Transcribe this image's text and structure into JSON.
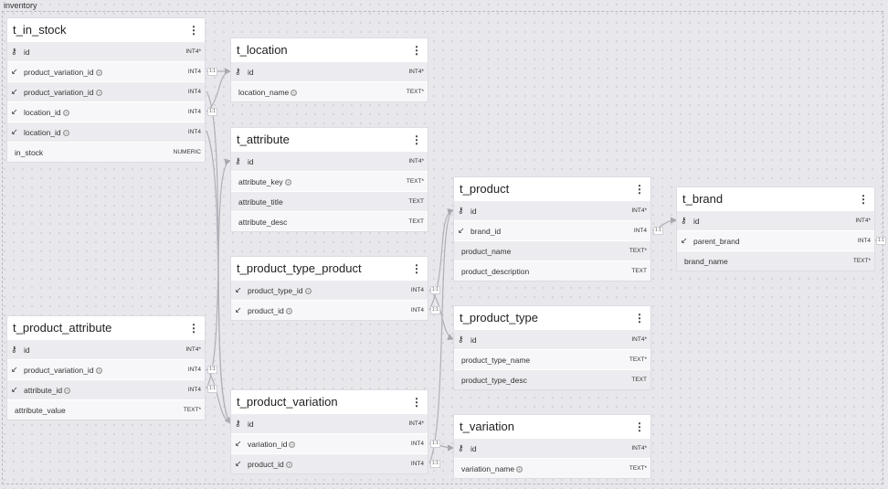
{
  "group_label": "inventory",
  "icons": {
    "pk": "key-icon",
    "fk": "arrow-southwest-icon",
    "menu": "kebab-menu-icon",
    "ref": "fingerprint-icon"
  },
  "colors": {
    "canvas": "#e7e7ec",
    "header": "#ffffff",
    "link": "#b0b0b8"
  },
  "cardinality": "1:1",
  "tables": {
    "t_in_stock": {
      "name": "t_in_stock",
      "columns": [
        {
          "name": "id",
          "type": "INT4*",
          "kind": "pk"
        },
        {
          "name": "product_variation_id",
          "type": "INT4",
          "kind": "fk",
          "ref": true
        },
        {
          "name": "product_variation_id",
          "type": "INT4",
          "kind": "fk",
          "ref": true
        },
        {
          "name": "location_id",
          "type": "INT4",
          "kind": "fk",
          "ref": true
        },
        {
          "name": "location_id",
          "type": "INT4",
          "kind": "fk",
          "ref": true
        },
        {
          "name": "in_stock",
          "type": "NUMERIC",
          "kind": "col"
        }
      ]
    },
    "t_location": {
      "name": "t_location",
      "columns": [
        {
          "name": "id",
          "type": "INT4*",
          "kind": "pk"
        },
        {
          "name": "location_name",
          "type": "TEXT*",
          "kind": "col",
          "ref": true
        }
      ]
    },
    "t_attribute": {
      "name": "t_attribute",
      "columns": [
        {
          "name": "id",
          "type": "INT4*",
          "kind": "pk"
        },
        {
          "name": "attribute_key",
          "type": "TEXT*",
          "kind": "col",
          "ref": true
        },
        {
          "name": "attribute_title",
          "type": "TEXT",
          "kind": "col"
        },
        {
          "name": "attribute_desc",
          "type": "TEXT",
          "kind": "col"
        }
      ]
    },
    "t_product_type_product": {
      "name": "t_product_type_product",
      "columns": [
        {
          "name": "product_type_id",
          "type": "INT4",
          "kind": "fk",
          "ref": true
        },
        {
          "name": "product_id",
          "type": "INT4",
          "kind": "fk",
          "ref": true
        }
      ]
    },
    "t_product_attribute": {
      "name": "t_product_attribute",
      "columns": [
        {
          "name": "id",
          "type": "INT4*",
          "kind": "pk"
        },
        {
          "name": "product_variation_id",
          "type": "INT4",
          "kind": "fk",
          "ref": true
        },
        {
          "name": "attribute_id",
          "type": "INT4",
          "kind": "fk",
          "ref": true
        },
        {
          "name": "attribute_value",
          "type": "TEXT*",
          "kind": "col"
        }
      ]
    },
    "t_product_variation": {
      "name": "t_product_variation",
      "columns": [
        {
          "name": "id",
          "type": "INT4*",
          "kind": "pk"
        },
        {
          "name": "variation_id",
          "type": "INT4",
          "kind": "fk",
          "ref": true
        },
        {
          "name": "product_id",
          "type": "INT4",
          "kind": "fk",
          "ref": true
        }
      ]
    },
    "t_product": {
      "name": "t_product",
      "columns": [
        {
          "name": "id",
          "type": "INT4*",
          "kind": "pk"
        },
        {
          "name": "brand_id",
          "type": "INT4",
          "kind": "fk"
        },
        {
          "name": "product_name",
          "type": "TEXT*",
          "kind": "col"
        },
        {
          "name": "product_description",
          "type": "TEXT",
          "kind": "col"
        }
      ]
    },
    "t_product_type": {
      "name": "t_product_type",
      "columns": [
        {
          "name": "id",
          "type": "INT4*",
          "kind": "pk"
        },
        {
          "name": "product_type_name",
          "type": "TEXT*",
          "kind": "col"
        },
        {
          "name": "product_type_desc",
          "type": "TEXT",
          "kind": "col"
        }
      ]
    },
    "t_variation": {
      "name": "t_variation",
      "columns": [
        {
          "name": "id",
          "type": "INT4*",
          "kind": "pk"
        },
        {
          "name": "variation_name",
          "type": "TEXT*",
          "kind": "col",
          "ref": true
        }
      ]
    },
    "t_brand": {
      "name": "t_brand",
      "columns": [
        {
          "name": "id",
          "type": "INT4*",
          "kind": "pk"
        },
        {
          "name": "parent_brand",
          "type": "INT4",
          "kind": "fk"
        },
        {
          "name": "brand_name",
          "type": "TEXT*",
          "kind": "col"
        }
      ]
    }
  }
}
